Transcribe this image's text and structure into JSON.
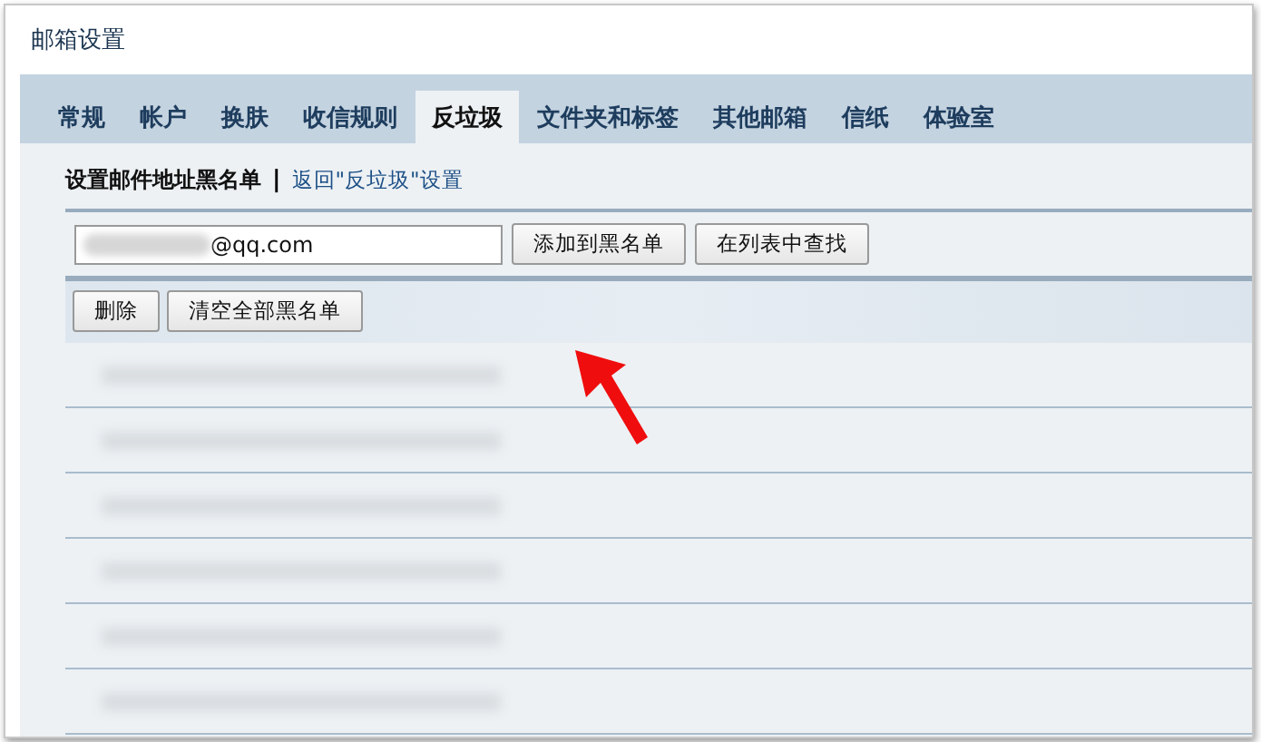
{
  "window": {
    "title": "邮箱设置"
  },
  "tabs": [
    {
      "label": "常规",
      "selected": false
    },
    {
      "label": "帐户",
      "selected": false
    },
    {
      "label": "换肤",
      "selected": false
    },
    {
      "label": "收信规则",
      "selected": false
    },
    {
      "label": "反垃圾",
      "selected": true
    },
    {
      "label": "文件夹和标签",
      "selected": false
    },
    {
      "label": "其他邮箱",
      "selected": false
    },
    {
      "label": "信纸",
      "selected": false
    },
    {
      "label": "体验室",
      "selected": false
    }
  ],
  "section": {
    "title": "设置邮件地址黑名单",
    "separator": "|",
    "back_link": "返回\"反垃圾\"设置"
  },
  "address_field": {
    "value": "@qq.com"
  },
  "add_buttons": [
    "添加到黑名单",
    "在列表中查找"
  ],
  "list_buttons": [
    "删除",
    "清空全部黑名单"
  ]
}
